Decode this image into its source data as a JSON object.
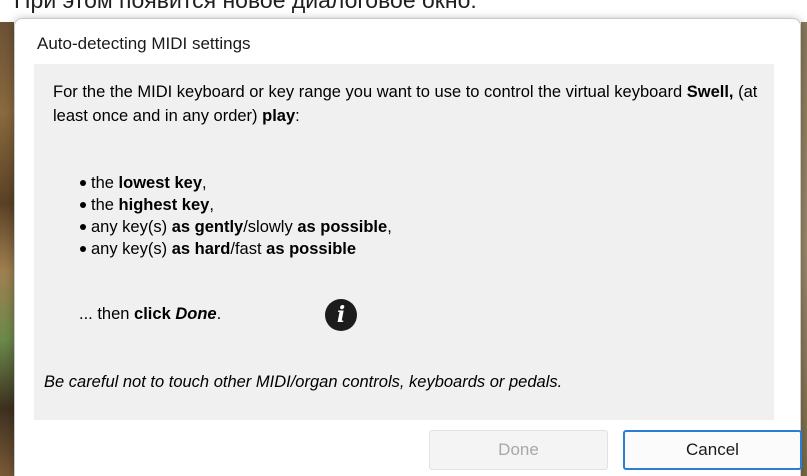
{
  "background": {
    "caption": "При этом появится новое диалоговое окно:"
  },
  "dialog": {
    "title": "Auto-detecting MIDI settings",
    "intro": {
      "part1": "For the the MIDI keyboard or key range you want to use to control the virtual keyboard ",
      "keyboard_name": "Swell,",
      "part2": " (at least once and in any order) ",
      "play": "play",
      "colon": ":"
    },
    "bullets": [
      {
        "pre": "the ",
        "bold": "lowest key",
        "post": ","
      },
      {
        "pre": "the ",
        "bold": "highest key",
        "post": ","
      },
      {
        "pre": "any key(s) ",
        "bold": "as gently",
        "mid": "/slowly ",
        "bold2": "as possible",
        "post": ","
      },
      {
        "pre": "any key(s) ",
        "bold": "as hard",
        "mid": "/fast ",
        "bold2": "as possible",
        "post": ""
      }
    ],
    "then": {
      "prefix": "... then ",
      "click": "click",
      "space": " ",
      "done": "Done",
      "period": "."
    },
    "info_icon": "i",
    "warning": "Be careful not to touch other MIDI/organ controls, keyboards or pedals.",
    "buttons": {
      "done": "Done",
      "cancel": "Cancel"
    }
  },
  "colors": {
    "content_bg": "#f0f0f0",
    "cancel_border": "#2a7fd4",
    "done_disabled_text": "#a8a8a8"
  },
  "icons": {
    "info": "info-circle-icon"
  }
}
